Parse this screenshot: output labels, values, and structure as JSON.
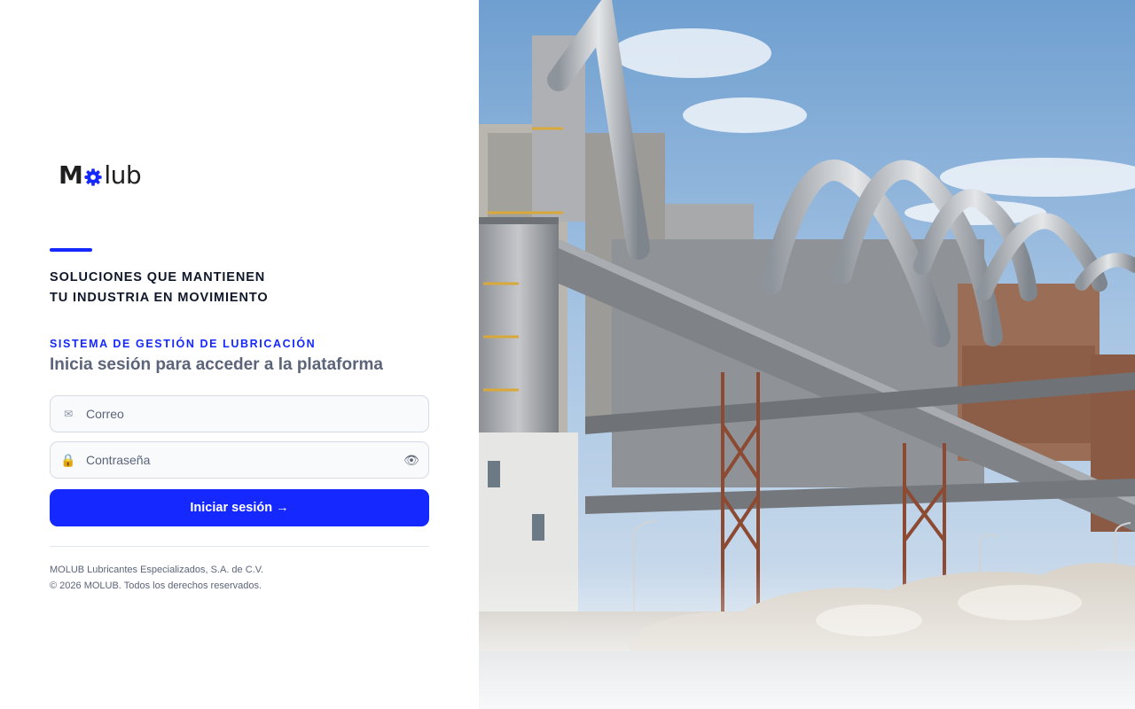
{
  "brand": {
    "logo_m": "M",
    "logo_rest": "lub",
    "gear_color": "#1428ff"
  },
  "hero": {
    "tagline_line1": "SOLUCIONES QUE MANTIENEN",
    "tagline_line2": "TU INDUSTRIA EN MOVIMIENTO"
  },
  "login": {
    "system_label": "SISTEMA DE GESTIÓN DE LUBRICACIÓN",
    "subtitle": "Inicia sesión para acceder a la plataforma",
    "email": {
      "placeholder": "Correo",
      "value": "",
      "icon": "mail-icon",
      "icon_glyph": "✉"
    },
    "password": {
      "placeholder": "Contraseña",
      "value": "",
      "icon": "lock-icon",
      "icon_glyph": "🔒",
      "toggle_icon": "eye-icon",
      "toggle_glyph": "👁"
    },
    "submit_label": "Iniciar sesión →"
  },
  "footer": {
    "company": "MOLUB Lubricantes Especializados, S.A. de C.V.",
    "copyright": "© 2026 MOLUB. Todos los derechos reservados."
  },
  "theme": {
    "accent": "#1428ff",
    "text_dark": "#0f172a",
    "text_muted": "#5b6478"
  }
}
